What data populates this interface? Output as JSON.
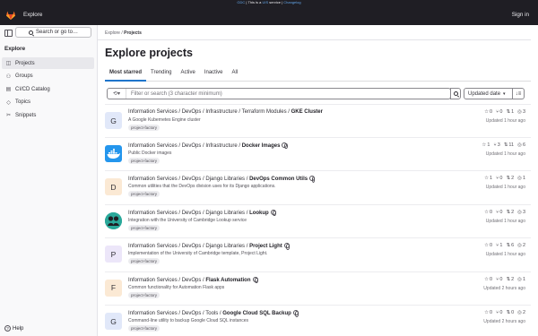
{
  "banner": {
    "pre": "GDC",
    "mid": "| This is a ",
    "service": "UIS",
    "post": " service |",
    "tail": "Changelog"
  },
  "topbar": {
    "app_name": "Explore",
    "sign_in": "Sign in"
  },
  "sidebar": {
    "search_label": "Search or go to…",
    "heading": "Explore",
    "items": [
      {
        "label": "Projects",
        "icon": "project-icon",
        "active": true
      },
      {
        "label": "Groups",
        "icon": "group-icon",
        "active": false
      },
      {
        "label": "CI/CD Catalog",
        "icon": "catalog-icon",
        "active": false
      },
      {
        "label": "Topics",
        "icon": "label-icon",
        "active": false
      },
      {
        "label": "Snippets",
        "icon": "snippet-icon",
        "active": false
      }
    ],
    "help": "Help"
  },
  "breadcrumb": {
    "root": "Explore",
    "sep": "/",
    "current": "Projects"
  },
  "page_title": "Explore projects",
  "tabs": [
    {
      "label": "Most starred",
      "active": true
    },
    {
      "label": "Trending",
      "active": false
    },
    {
      "label": "Active",
      "active": false
    },
    {
      "label": "Inactive",
      "active": false
    },
    {
      "label": "All",
      "active": false
    }
  ],
  "filter": {
    "placeholder": "Filter or search (3 character minimum)",
    "sort_label": "Updated date",
    "sort_dir": "↓≡"
  },
  "projects": [
    {
      "avatar": "G",
      "avatar_class": "av-g",
      "path": "Information Services / DevOps / Infrastructure / Terraform Modules / ",
      "name": "GKE Cluster",
      "public": false,
      "desc": "A Google Kubernetes Engine cluster",
      "topic": "project-factory",
      "stars": "0",
      "forks": "0",
      "mrs": "1",
      "issues": "3",
      "updated": "Updated 1 hour ago"
    },
    {
      "avatar": "",
      "avatar_class": "av-docker",
      "path": "Information Services / DevOps / Infrastructure / ",
      "name": "Docker Images",
      "public": true,
      "desc": "Public Docker images",
      "topic": "project-factory",
      "stars": "1",
      "forks": "3",
      "mrs": "11",
      "issues": "6",
      "updated": "Updated 1 hour ago"
    },
    {
      "avatar": "D",
      "avatar_class": "av-d",
      "path": "Information Services / DevOps / Django Libraries / ",
      "name": "DevOps Common Utils",
      "public": true,
      "desc": "Common utilities that the DevOps division uses for its Django applications.",
      "topic": "project-factory",
      "stars": "1",
      "forks": "0",
      "mrs": "2",
      "issues": "1",
      "updated": "Updated 1 hour ago"
    },
    {
      "avatar": "",
      "avatar_class": "av-lookup",
      "path": "Information Services / DevOps / Django Libraries / ",
      "name": "Lookup",
      "public": true,
      "desc": "Integration with the University of Cambridge Lookup service",
      "topic": "project-factory",
      "stars": "0",
      "forks": "0",
      "mrs": "2",
      "issues": "3",
      "updated": "Updated 1 hour ago"
    },
    {
      "avatar": "P",
      "avatar_class": "av-p",
      "path": "Information Services / DevOps / Django Libraries / ",
      "name": "Project Light",
      "public": true,
      "desc": "Implementation of the University of Cambridge template, Project Light.",
      "topic": "project-factory",
      "stars": "0",
      "forks": "1",
      "mrs": "6",
      "issues": "2",
      "updated": "Updated 1 hour ago"
    },
    {
      "avatar": "F",
      "avatar_class": "av-f",
      "path": "Information Services / DevOps / ",
      "name": "Flask Automation",
      "public": true,
      "desc": "Common functionality for Automation Flask apps",
      "topic": "project-factory",
      "stars": "0",
      "forks": "0",
      "mrs": "2",
      "issues": "1",
      "updated": "Updated 2 hours ago"
    },
    {
      "avatar": "G",
      "avatar_class": "av-g",
      "path": "Information Services / DevOps / Tools / ",
      "name": "Google Cloud SQL Backup",
      "public": true,
      "desc": "Command-line utility to backup Google Cloud SQL instances",
      "topic": "project-factory",
      "stars": "0",
      "forks": "0",
      "mrs": "0",
      "issues": "2",
      "updated": "Updated 2 hours ago"
    }
  ]
}
